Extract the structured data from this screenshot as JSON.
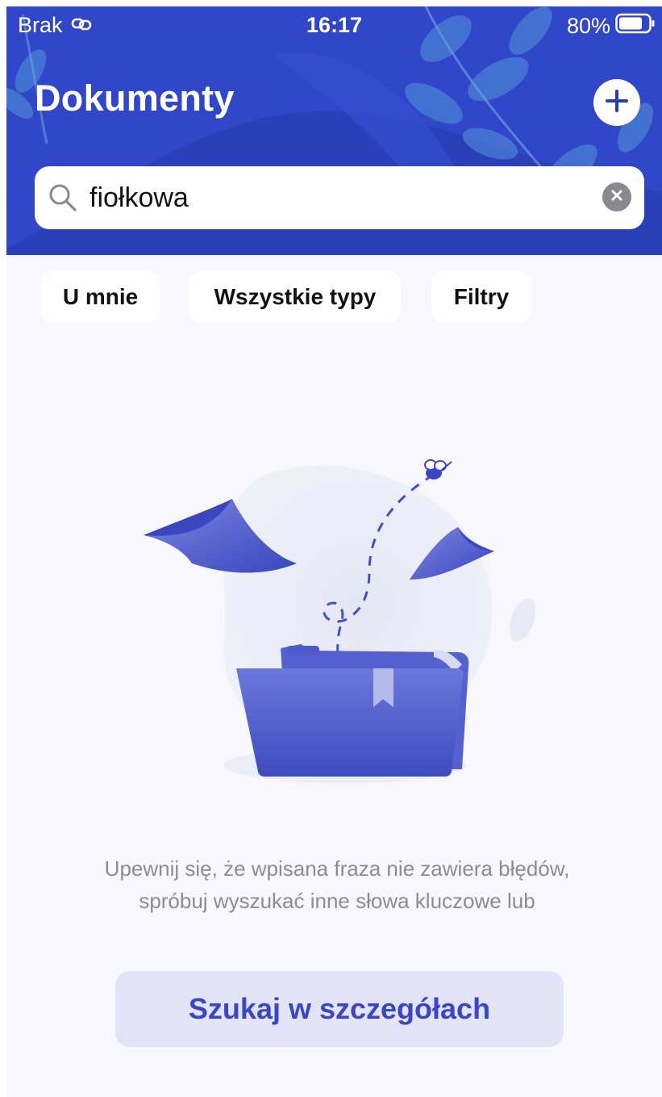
{
  "status_bar": {
    "carrier": "Brak",
    "time": "16:17",
    "battery": "80%"
  },
  "header": {
    "title": "Dokumenty"
  },
  "search": {
    "value": "fiołkowa"
  },
  "filters": [
    {
      "label": "U mnie"
    },
    {
      "label": "Wszystkie typy"
    },
    {
      "label": "Filtry"
    }
  ],
  "empty_state": {
    "message": "Upewnij się, że wpisana fraza nie zawiera błędów, spróbuj wyszukać inne słowa kluczowe lub",
    "button_label": "Szukaj w szczegółach"
  },
  "colors": {
    "header_bg": "#2f47c8",
    "accent": "#3b46c4",
    "button_bg": "#e2e3f6",
    "page_bg": "#f7f7fd"
  },
  "battery_level": 0.8
}
